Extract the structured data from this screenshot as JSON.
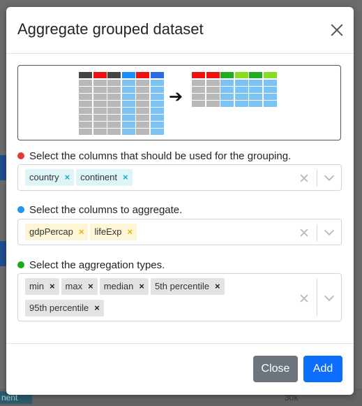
{
  "modal": {
    "title": "Aggregate grouped dataset"
  },
  "illustration": {
    "colors": {
      "dark": "#444444",
      "red": "#ee1111",
      "blue": "#1a8cff",
      "blue_dark": "#2a6be0",
      "gray": "#b8b8b8",
      "light_blue": "#7cc2f2",
      "green": "#22aa22",
      "lime": "#88dd22"
    },
    "arrow": "➔"
  },
  "grouping": {
    "label": "Select the columns that should be used for the grouping.",
    "dot_color": "#e53935",
    "chips": [
      "country",
      "continent"
    ]
  },
  "aggregate": {
    "label": "Select the columns to aggregate.",
    "dot_color": "#2196f3",
    "chips": [
      "gdpPercap",
      "lifeExp"
    ]
  },
  "types": {
    "label": "Select the aggregation types.",
    "dot_color": "#1aaa1a",
    "chips": [
      "min",
      "max",
      "median",
      "5th percentile",
      "95th percentile"
    ]
  },
  "remove_glyph": "×",
  "footer": {
    "close_label": "Close",
    "add_label": "Add"
  },
  "background": {
    "chip_text": "nent",
    "value_text": "30k"
  }
}
